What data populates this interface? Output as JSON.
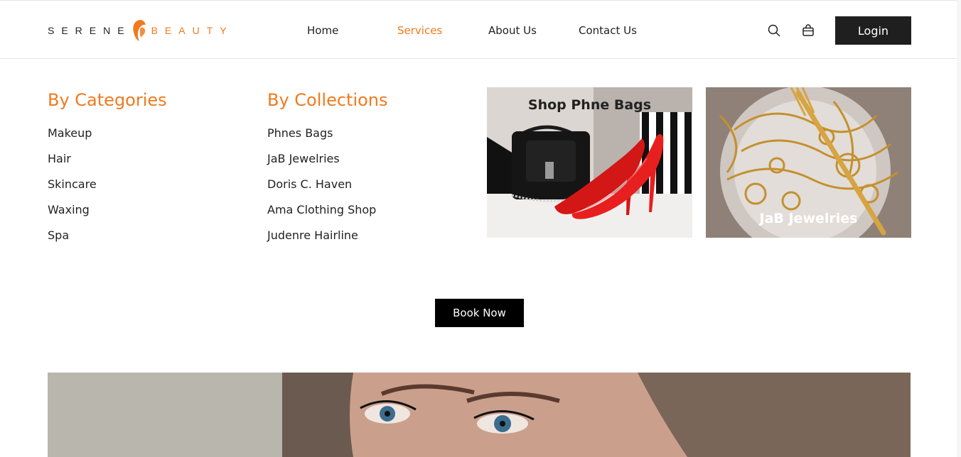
{
  "brand": {
    "word1": "SERENE",
    "word2": "BEAUTY",
    "accent": "#f07a1d"
  },
  "nav": {
    "items": [
      {
        "label": "Home",
        "active": false
      },
      {
        "label": "Services",
        "active": true
      },
      {
        "label": "About Us",
        "active": false
      },
      {
        "label": "Contact Us",
        "active": false
      }
    ]
  },
  "actions": {
    "search_icon": "search-icon",
    "bag_icon": "shopping-bag-icon",
    "login_label": "Login"
  },
  "menu": {
    "categories": {
      "title": "By Categories",
      "items": [
        "Makeup",
        "Hair",
        "Skincare",
        "Waxing",
        "Spa"
      ]
    },
    "collections": {
      "title": "By Collections",
      "items": [
        "Phnes Bags",
        "JaB Jewelries",
        "Doris C. Haven",
        "Ama Clothing Shop",
        "Judenre Hairline"
      ]
    }
  },
  "promos": [
    {
      "caption": "Shop Phne Bags"
    },
    {
      "caption": "JaB Jewelries"
    }
  ],
  "cta": {
    "book_label": "Book Now"
  }
}
